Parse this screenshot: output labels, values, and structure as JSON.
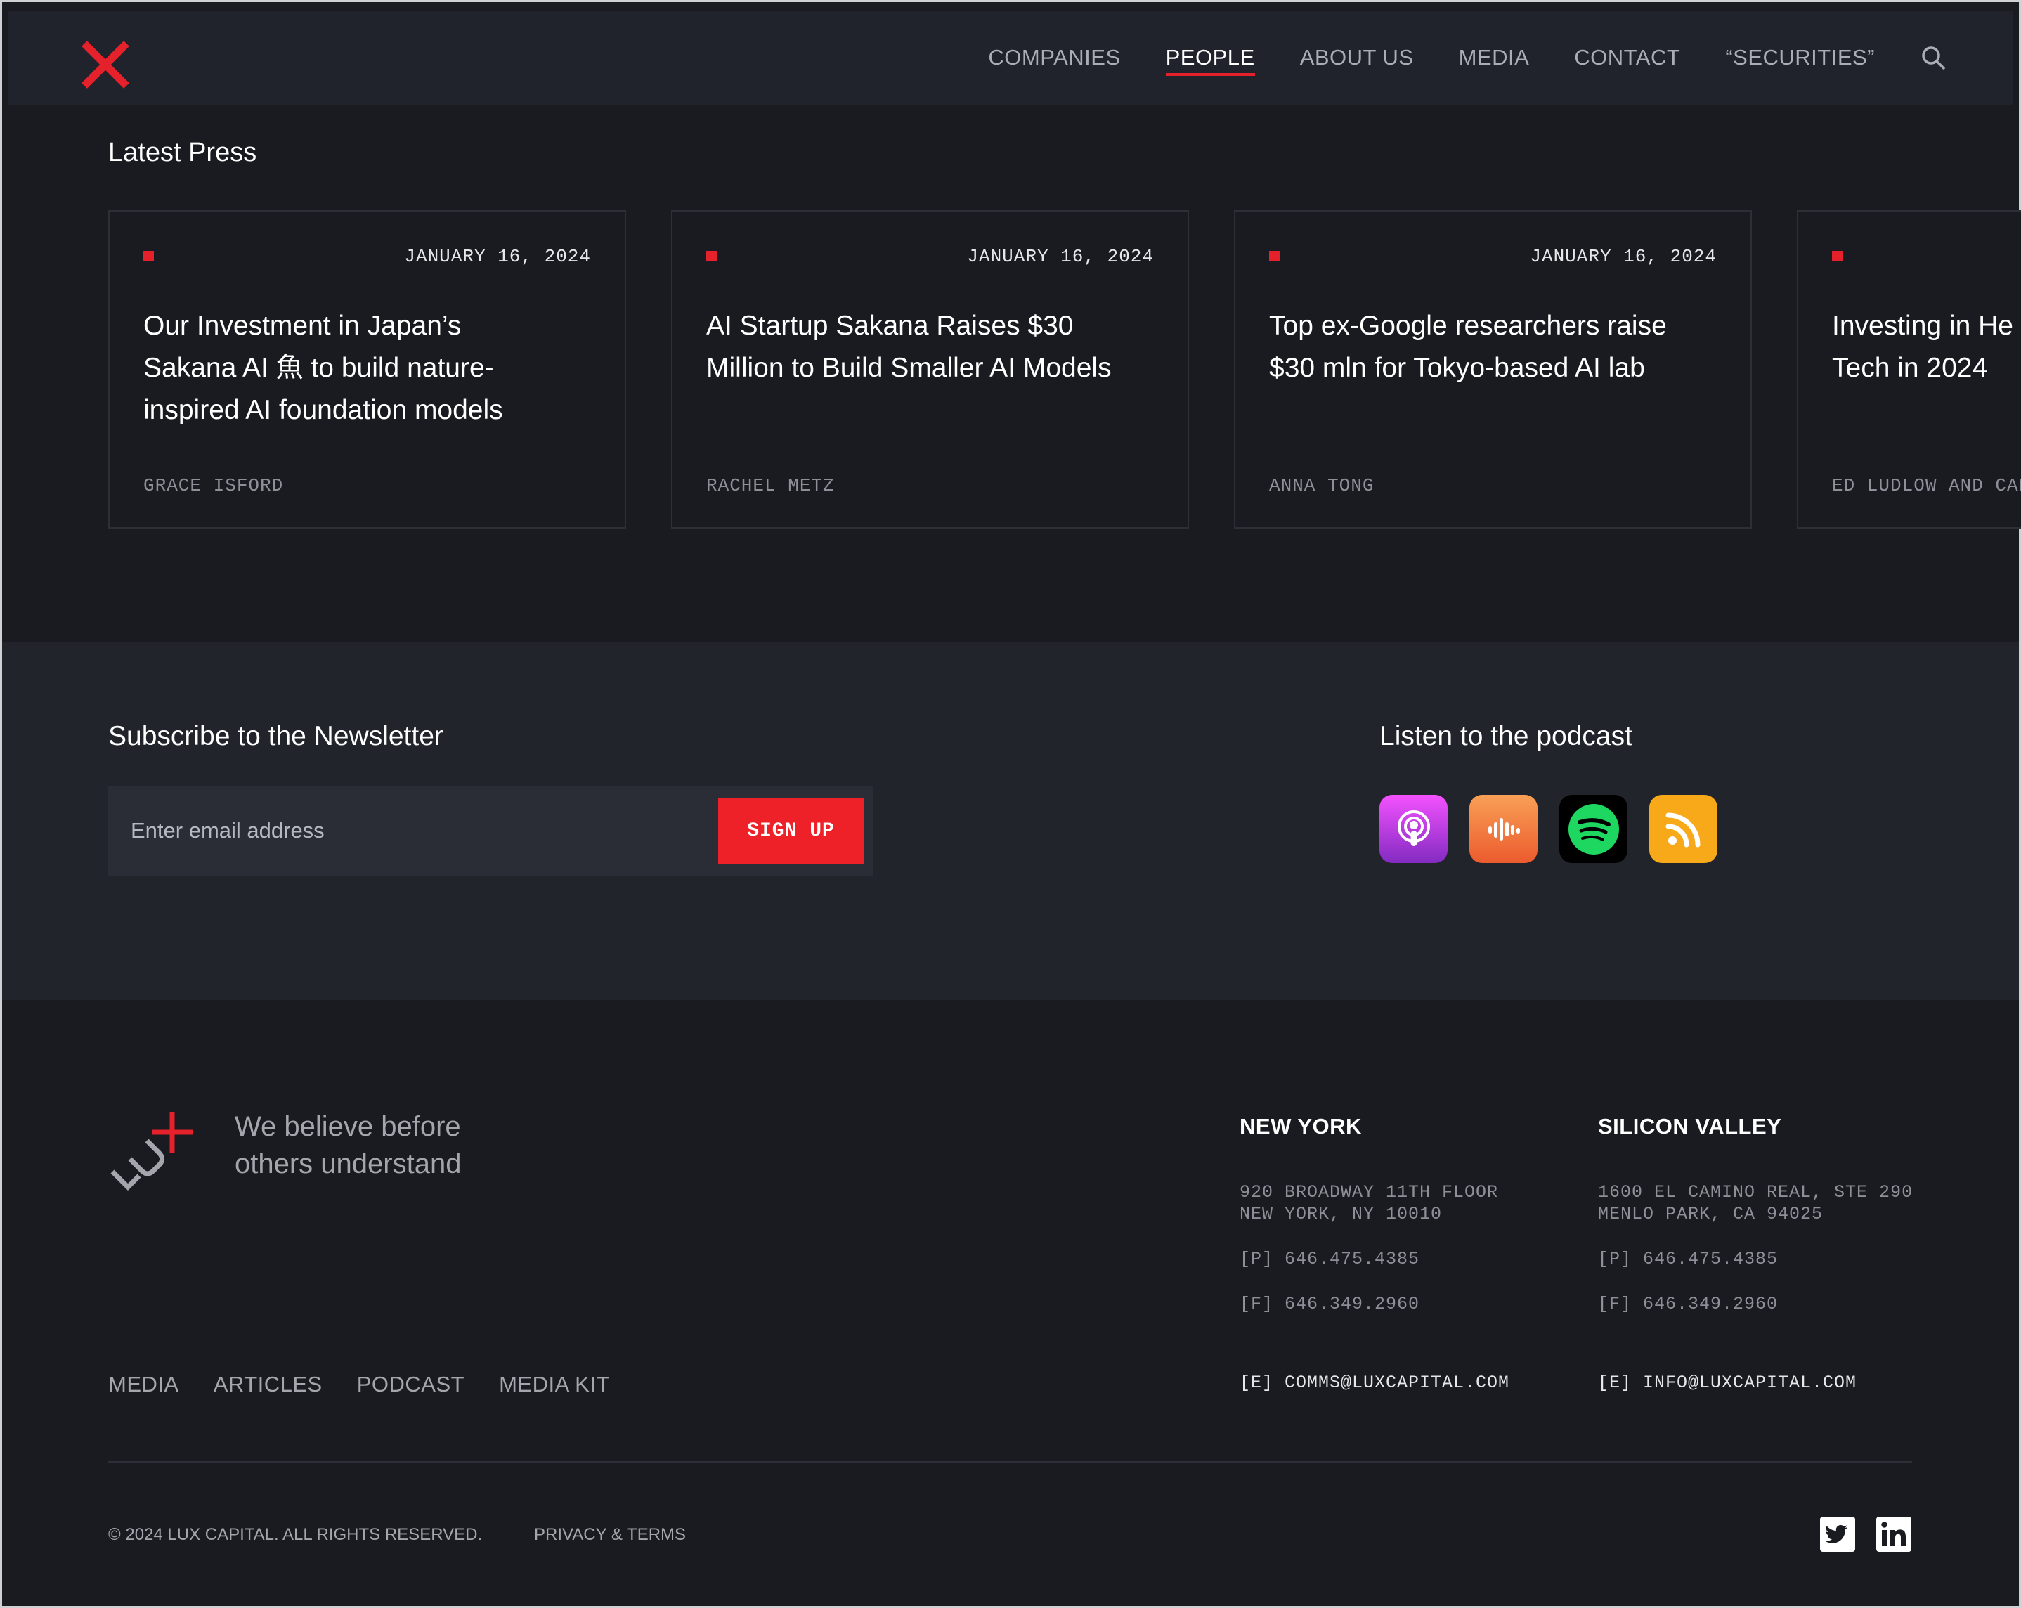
{
  "header": {
    "nav": [
      "COMPANIES",
      "PEOPLE",
      "ABOUT US",
      "MEDIA",
      "CONTACT",
      "“SECURITIES”"
    ],
    "active_nav": "PEOPLE",
    "accent_color": "#e5222b"
  },
  "press": {
    "title": "Latest Press",
    "cards": [
      {
        "date": "JANUARY 16, 2024",
        "headline_lines": [
          "Our Investment in Japan’s",
          "Sakana AI 魚 to build nature-",
          "inspired AI foundation models"
        ],
        "author": "GRACE ISFORD"
      },
      {
        "date": "JANUARY 16, 2024",
        "headline_lines": [
          "AI Startup Sakana Raises $30",
          "Million to Build Smaller AI Models"
        ],
        "author": "RACHEL METZ"
      },
      {
        "date": "JANUARY 16, 2024",
        "headline_lines": [
          "Top ex-Google researchers raise",
          "$30 mln for Tokyo-based AI lab"
        ],
        "author": "ANNA TONG"
      },
      {
        "date": "",
        "headline_lines": [
          "Investing in He",
          "Tech in 2024"
        ],
        "author": "ED LUDLOW AND CAR"
      }
    ]
  },
  "newsletter": {
    "title": "Subscribe to the Newsletter",
    "placeholder": "Enter email address",
    "button": "SIGN UP"
  },
  "podcast": {
    "title": "Listen to the podcast",
    "platforms": [
      "apple-podcasts-icon",
      "castbox-icon",
      "spotify-icon",
      "rss-icon"
    ]
  },
  "footer": {
    "tagline_lines": [
      "We believe before",
      "others understand"
    ],
    "offices": [
      {
        "name": "NEW YORK",
        "address_lines": [
          "920 BROADWAY 11TH FLOOR",
          "NEW YORK, NY 10010"
        ],
        "phone_label": "[P]",
        "phone": "646.475.4385",
        "fax_label": "[F]",
        "fax": "646.349.2960",
        "email_label": "[E]",
        "email": "COMMS@LUXCAPITAL.COM"
      },
      {
        "name": "SILICON VALLEY",
        "address_lines": [
          "1600 EL CAMINO REAL, STE 290",
          "MENLO PARK, CA 94025"
        ],
        "phone_label": "[P]",
        "phone": "646.475.4385",
        "fax_label": "[F]",
        "fax": "646.349.2960",
        "email_label": "[E]",
        "email": "INFO@LUXCAPITAL.COM"
      }
    ],
    "links": [
      "MEDIA",
      "ARTICLES",
      "PODCAST",
      "MEDIA KIT"
    ],
    "copyright": "© 2024 LUX CAPITAL. ALL RIGHTS RESERVED.",
    "privacy": "PRIVACY & TERMS",
    "social": [
      "twitter-icon",
      "linkedin-icon"
    ]
  }
}
